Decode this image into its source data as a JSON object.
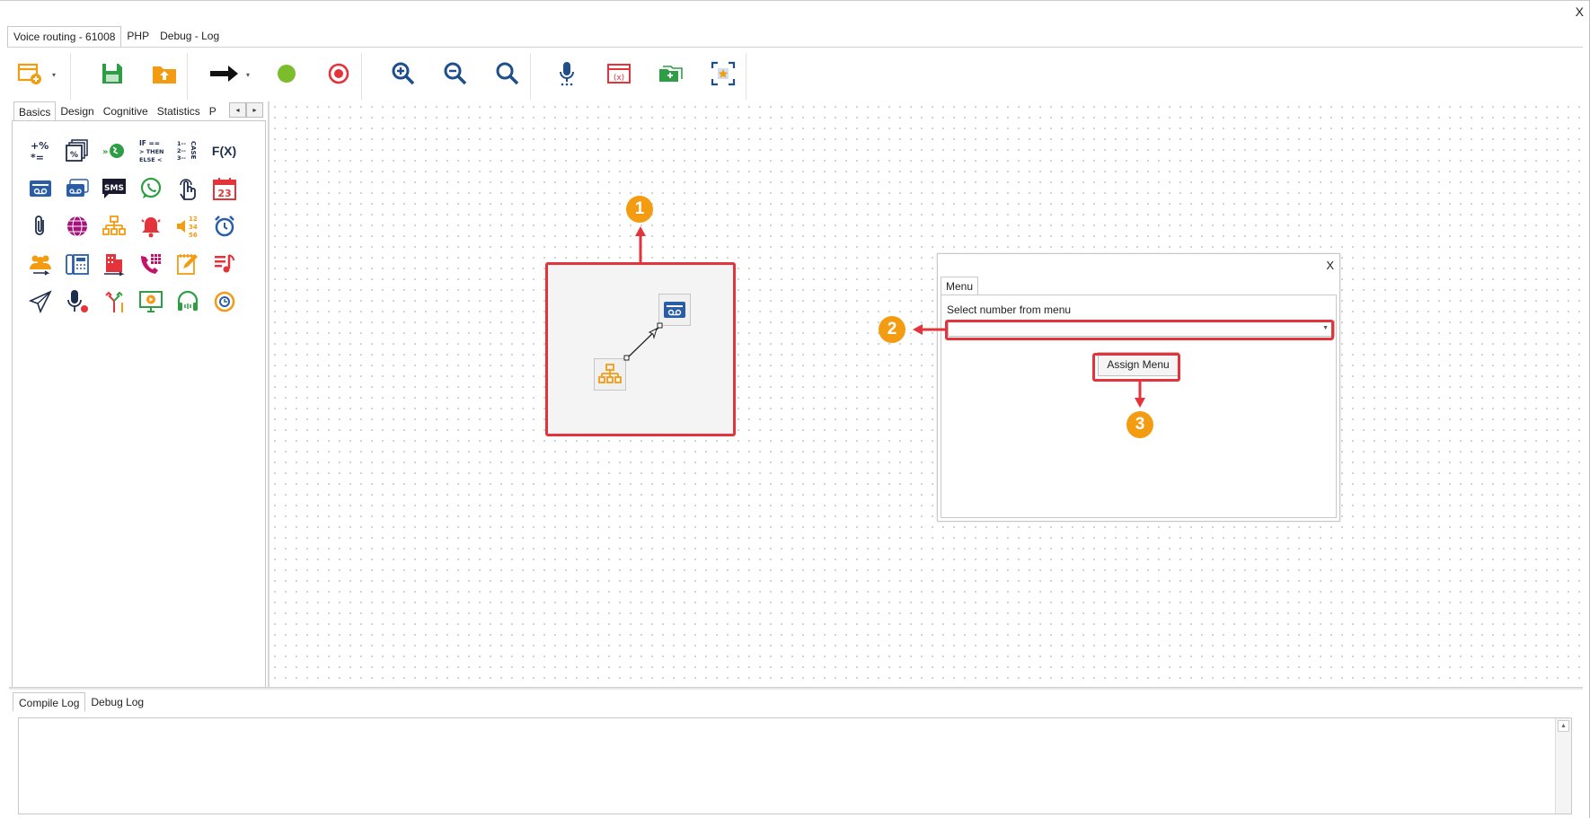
{
  "window": {
    "close_label": "X"
  },
  "doc_tabs": [
    {
      "label": "Voice routing - 61008",
      "active": true
    },
    {
      "label": "PHP",
      "active": false
    },
    {
      "label": "Debug - Log",
      "active": false
    }
  ],
  "toolbar": {
    "icons": [
      "new-window-icon",
      "save-icon",
      "upload-icon",
      "arrow-right-icon",
      "green-dot-icon",
      "record-icon",
      "zoom-in-icon",
      "zoom-out-icon",
      "zoom-fit-icon",
      "microphone-icon",
      "variable-icon",
      "add-folder-icon",
      "focus-frame-icon"
    ],
    "accent_colors": {
      "save": "#2e9e44",
      "upload": "#f39c12",
      "red": "#e5333b",
      "blue": "#1f4f8b",
      "green_dot": "#7cbd2d"
    }
  },
  "palette": {
    "tabs": [
      {
        "label": "Basics",
        "active": true
      },
      {
        "label": "Design",
        "active": false
      },
      {
        "label": "Cognitive",
        "active": false
      },
      {
        "label": "Statistics",
        "active": false
      },
      {
        "label": "P",
        "active": false
      }
    ],
    "scroll_left": "◂",
    "scroll_right": "▸",
    "items": [
      "math-icon",
      "percentage-cards-icon",
      "goto-globe-icon",
      "if-then-else-icon",
      "case-icon",
      "function-icon",
      "voicemail-icon",
      "voicemail-stack-icon",
      "sms-icon",
      "whatsapp-icon",
      "touch-input-icon",
      "calendar-icon",
      "paperclip-icon",
      "web-globe-icon",
      "menu-tree-icon",
      "alarm-bell-icon",
      "say-numbers-icon",
      "alarm-clock-icon",
      "queue-group-icon",
      "phone-dial-icon",
      "transfer-building-icon",
      "keypad-icon",
      "note-edit-icon",
      "music-playlist-icon",
      "send-plane-icon",
      "record-mic-icon",
      "split-route-icon",
      "screen-play-icon",
      "headset-icon",
      "timer-alarm-icon"
    ],
    "function_label": "F(X)",
    "sms_label": "SMS",
    "calendar_label": "23",
    "if_lines": [
      "IF ==",
      "> THEN",
      "ELSE <"
    ],
    "case_label": "CASE",
    "numbers_label": "12 34 56"
  },
  "canvas": {
    "badges": [
      "1",
      "2",
      "3"
    ]
  },
  "dialog": {
    "close_label": "X",
    "tab_label": "Menu",
    "field_label": "Select number from menu",
    "select_value": "",
    "button_label": "Assign Menu"
  },
  "log_tabs": [
    {
      "label": "Compile Log",
      "active": true
    },
    {
      "label": "Debug Log",
      "active": false
    }
  ]
}
